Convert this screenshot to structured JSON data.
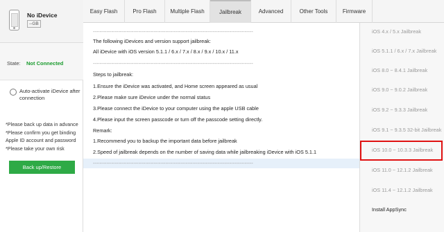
{
  "device": {
    "name": "No iDevice",
    "capacity": "--GB"
  },
  "state": {
    "label": "State:",
    "value": "Not Connected"
  },
  "auto_activate": {
    "label": "Auto-activate iDevice after connection"
  },
  "notes": [
    "*Please back up data in advance",
    "*Please confirm you get binding",
    " Apple ID account and password",
    "*Please take your own risk"
  ],
  "backup_button": "Back up/Restore",
  "tabs": [
    {
      "label": "Easy Flash"
    },
    {
      "label": "Pro Flash"
    },
    {
      "label": "Multiple Flash"
    },
    {
      "label": "Jailbreak",
      "active": true
    },
    {
      "label": "Advanced"
    },
    {
      "label": "Other Tools"
    },
    {
      "label": "Firmware"
    }
  ],
  "content": {
    "lines": [
      "-----------------------------------------------------------------------------------------------",
      "The following iDevices and version support jailbreak:",
      "All iDevice with iOS version 5.1.1 / 6.x / 7.x / 8.x / 9.x / 10.x / 11.x",
      "-----------------------------------------------------------------------------------------------",
      "Steps to jailbreak:",
      "1.Ensure the iDevice was activated, and Home screen appeared as usual",
      "2.Please make sure iDevice under the normal status",
      "3.Please connect the iDevice to your computer using the apple USB cable",
      "4.Please input the screen passcode or turn off the passcode setting directly.",
      "Remark:",
      "1.Recommend you to backup the important data before jailbreak",
      "2.Speed of jailbreak depends on the number of saving data while jailbreaking iDevice with iOS 5.1.1",
      "-----------------------------------------------------------------------------------------------"
    ]
  },
  "jailbreak_options": [
    {
      "label": "iOS 4.x / 5.x Jailbreak",
      "enabled": false
    },
    {
      "label": "iOS 5.1.1 / 6.x / 7.x Jailbreak",
      "enabled": false
    },
    {
      "label": "iOS 8.0 ~ 8.4.1 Jailbreak",
      "enabled": false
    },
    {
      "label": "iOS 9.0 ~ 9.0.2 Jailbreak",
      "enabled": false
    },
    {
      "label": "iOS 9.2 ~ 9.3.3 Jailbreak",
      "enabled": false
    },
    {
      "label": "iOS 9.1 ~ 9.3.5 32-bit Jailbreak",
      "enabled": false
    },
    {
      "label": "iOS 10.0 ~ 10.3.3 Jailbreak",
      "enabled": false,
      "highlighted": true
    },
    {
      "label": "iOS 11.0 ~ 12.1.2 Jailbreak",
      "enabled": false
    },
    {
      "label": "iOS 11.4 ~ 12.1.2 Jailbreak",
      "enabled": false
    },
    {
      "label": "Install AppSync",
      "enabled": true
    }
  ],
  "colors": {
    "accent_green": "#2eaa46",
    "status_green": "#1a9b2e",
    "highlight_red": "#e01010"
  }
}
